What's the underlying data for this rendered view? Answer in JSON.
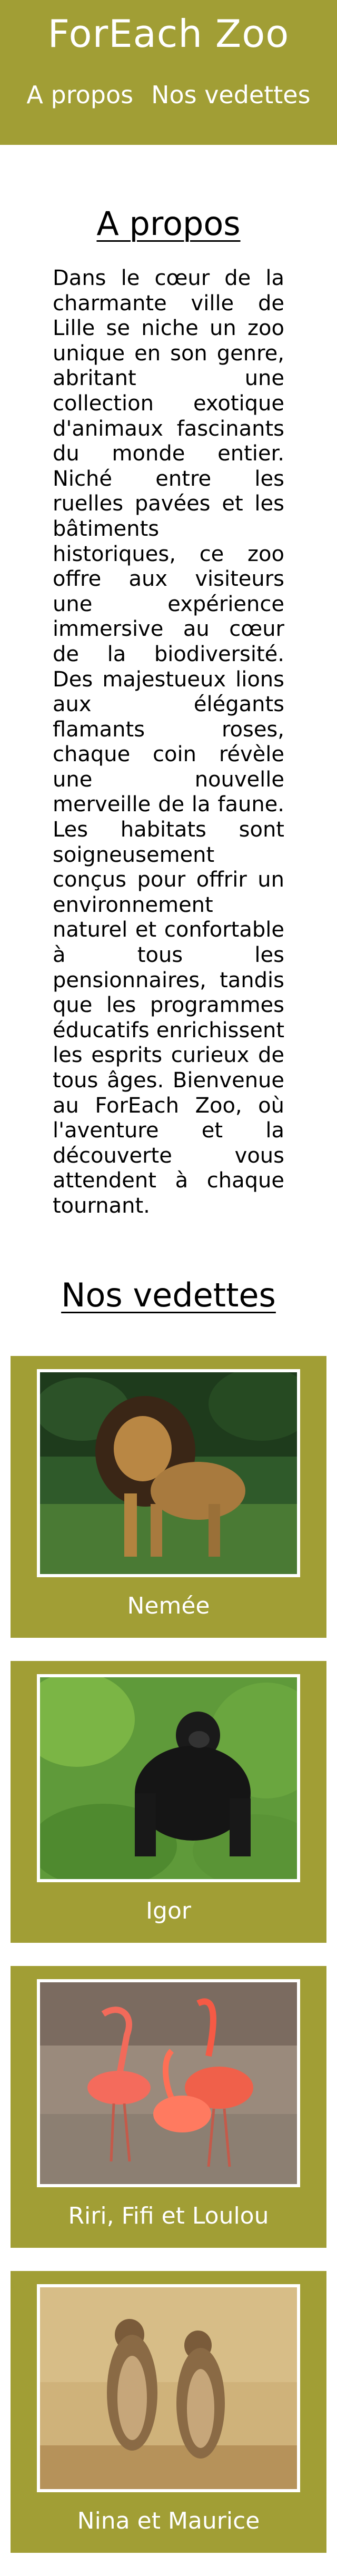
{
  "header": {
    "title": "ForEach Zoo",
    "nav": [
      {
        "label": "A propos"
      },
      {
        "label": "Nos vedettes"
      }
    ]
  },
  "about": {
    "title": "A propos",
    "text": "Dans le cœur de la charmante ville de Lille se niche un zoo unique en son genre, abritant une collection exotique d'animaux fascinants du monde entier. Niché entre les ruelles pavées et les bâtiments historiques, ce zoo offre aux visiteurs une expérience immersive au cœur de la biodiversité. Des majestueux lions aux élégants flamants roses, chaque coin révèle une nouvelle merveille de la faune. Les habitats sont soigneusement conçus pour offrir un environnement naturel et confortable à tous les pensionnaires, tandis que les programmes éducatifs enrichissent les esprits curieux de tous âges. Bienvenue au ForEach Zoo, où l'aventure et la découverte vous attendent à chaque tournant."
  },
  "stars": {
    "title": "Nos vedettes",
    "items": [
      {
        "name": "Nemée",
        "icon": "lion-photo"
      },
      {
        "name": "Igor",
        "icon": "gorilla-photo"
      },
      {
        "name": "Riri, Fifi et Loulou",
        "icon": "flamingos-photo"
      },
      {
        "name": "Nina et Maurice",
        "icon": "meerkats-photo"
      }
    ]
  },
  "colors": {
    "accent": "#a19e35",
    "background": "#ffffff",
    "text": "#000000"
  }
}
